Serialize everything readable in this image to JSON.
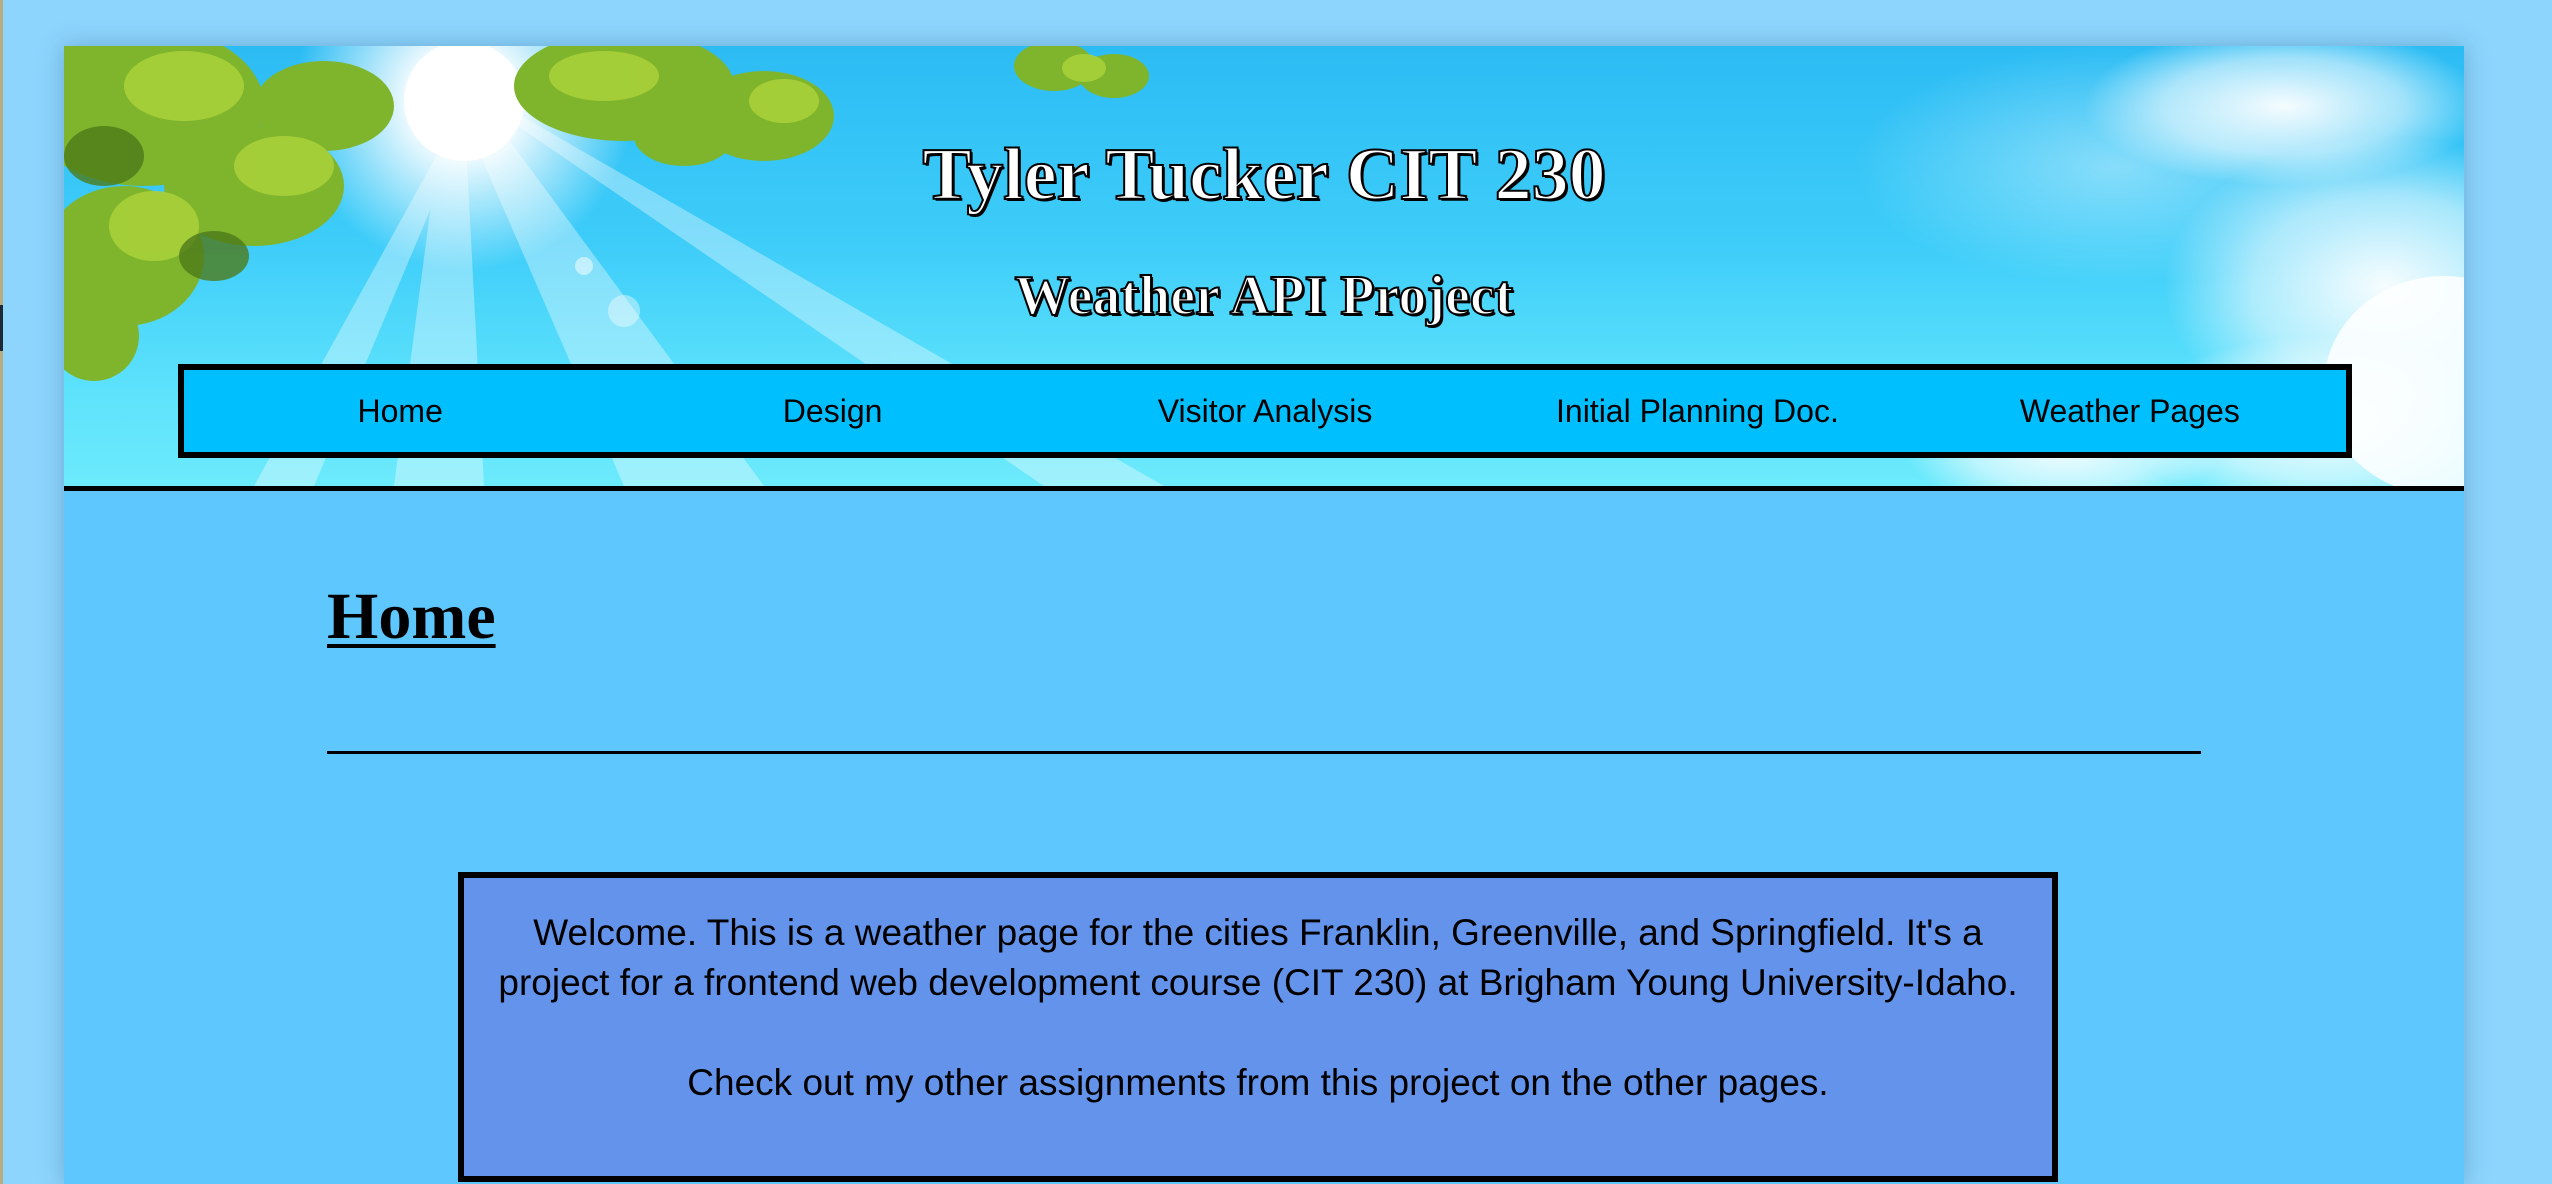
{
  "banner": {
    "title": "Tyler Tucker CIT 230",
    "subtitle": "Weather API Project"
  },
  "nav": {
    "items": [
      {
        "label": "Home"
      },
      {
        "label": "Design"
      },
      {
        "label": "Visitor Analysis"
      },
      {
        "label": "Initial Planning Doc."
      },
      {
        "label": "Weather Pages"
      }
    ]
  },
  "main": {
    "heading": "Home",
    "welcome_paragraphs": [
      "Welcome. This is a weather page for the cities Franklin, Greenville, and Springfield. It's a project for a frontend web development course (CIT 230) at Brigham Young University-Idaho.",
      "Check out my other assignments from this project on the other pages."
    ]
  },
  "colors": {
    "page_background": "#8dd5fd",
    "content_background": "#5ec7fd",
    "nav_background": "#00bfff",
    "welcome_box_background": "#6493ec",
    "border": "#000000"
  }
}
